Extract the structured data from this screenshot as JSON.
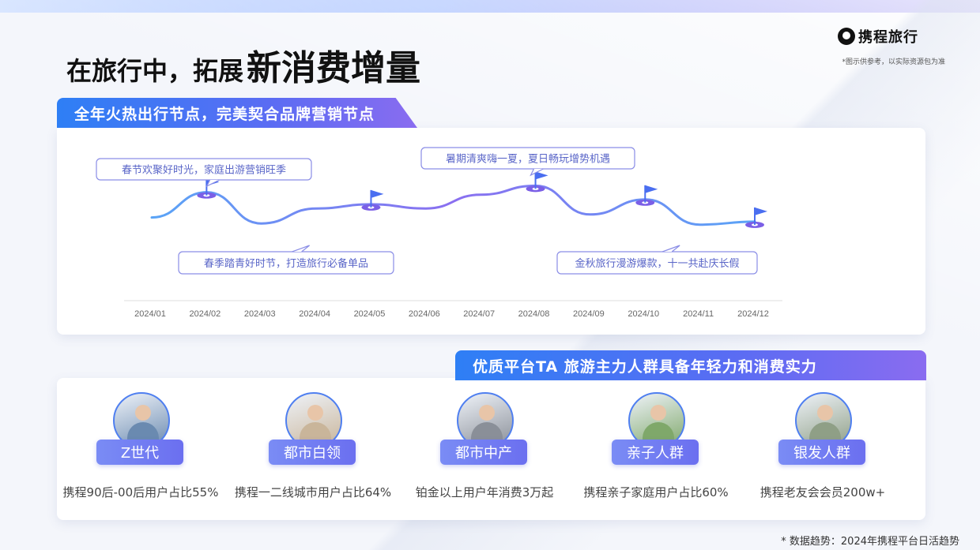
{
  "brand": {
    "logo_text": "携程旅行",
    "disclaimer": "*图示供参考，以实际资源包为准"
  },
  "title": {
    "prefix": "在旅行中，拓展",
    "emphasis": "新消费增量"
  },
  "section1": {
    "heading": "全年火热出行节点，完美契合品牌营销节点"
  },
  "section2": {
    "heading": "优质平台TA 旅游主力人群具备年轻力和消费实力"
  },
  "chart_data": {
    "type": "line",
    "x": [
      "2024/01",
      "2024/02",
      "2024/03",
      "2024/04",
      "2024/05",
      "2024/06",
      "2024/07",
      "2024/08",
      "2024/09",
      "2024/10",
      "2024/11",
      "2024/12"
    ],
    "series": [
      {
        "values": [
          0.4,
          0.82,
          0.3,
          0.55,
          0.62,
          0.55,
          0.78,
          0.93,
          0.45,
          0.7,
          0.28,
          0.33
        ]
      }
    ],
    "flags": [
      {
        "x": "2024/02"
      },
      {
        "x": "2024/05"
      },
      {
        "x": "2024/08"
      },
      {
        "x": "2024/10"
      },
      {
        "x": "2024/12"
      }
    ],
    "annotations": [
      {
        "text": "春节欢聚好时光，家庭出游营销旺季",
        "anchor": "2024/02",
        "placement": "above"
      },
      {
        "text": "春季踏青好时节，打造旅行必备单品",
        "anchor": "2024/05",
        "placement": "below"
      },
      {
        "text": "暑期清爽嗨一夏，夏日畅玩增势机遇",
        "anchor": "2024/08",
        "placement": "above"
      },
      {
        "text": "金秋旅行漫游爆款，十一共赴庆长假",
        "anchor": "2024/10",
        "placement": "below"
      }
    ],
    "ylabel": "",
    "xlabel": "",
    "grid": false
  },
  "personas": [
    {
      "label": "Z世代",
      "stat": "携程90后-00后用户占比55%",
      "icon": "snowboarder-avatar",
      "color": "#6a8ab0"
    },
    {
      "label": "都市白领",
      "stat": "携程一二线城市用户占比64%",
      "icon": "office-worker-avatar",
      "color": "#c9b59a"
    },
    {
      "label": "都市中产",
      "stat": "铂金以上用户年消费3万起",
      "icon": "executive-avatar",
      "color": "#8a8f98"
    },
    {
      "label": "亲子人群",
      "stat": "携程亲子家庭用户占比60%",
      "icon": "family-avatar",
      "color": "#7fa86a"
    },
    {
      "label": "银发人群",
      "stat": "携程老友会会员200w+",
      "icon": "senior-hikers-avatar",
      "color": "#8f9f86"
    }
  ],
  "footnote": "* 数据趋势：2024年携程平台日活趋势"
}
